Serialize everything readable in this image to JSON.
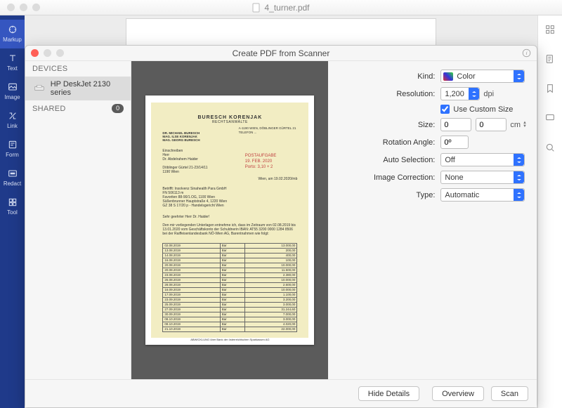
{
  "window": {
    "title": "4_turner.pdf"
  },
  "rail": {
    "items": [
      {
        "label": "Markup"
      },
      {
        "label": "Text"
      },
      {
        "label": "Image"
      },
      {
        "label": "Link"
      },
      {
        "label": "Form"
      },
      {
        "label": "Redact"
      },
      {
        "label": "Tool"
      }
    ]
  },
  "sheet": {
    "title": "Create PDF from Scanner",
    "devices_header": "DEVICES",
    "device_name": "HP DeskJet 2130 series",
    "shared_header": "SHARED",
    "shared_count": "0",
    "settings": {
      "kind_label": "Kind:",
      "kind_value": "Color",
      "res_label": "Resolution:",
      "res_value": "1,200",
      "res_unit": "dpi",
      "custom_label": "Use Custom Size",
      "size_label": "Size:",
      "size_w": "0",
      "size_h": "0",
      "size_unit": "cm",
      "rot_label": "Rotation Angle:",
      "rot_value": "0º",
      "auto_label": "Auto Selection:",
      "auto_value": "Off",
      "corr_label": "Image Correction:",
      "corr_value": "None",
      "type_label": "Type:",
      "type_value": "Automatic"
    },
    "buttons": {
      "hide": "Hide Details",
      "overview": "Overview",
      "scan": "Scan"
    }
  },
  "scanned": {
    "firm": "BURESCH   KORENJAK",
    "sub": "RECHTSANWÄLTE",
    "names": "DR. MICHAEL BURESCH\nMAG. ILSE KORENJAK\nMAG. GEORG BURESCH",
    "right_addr": "A-1190 WIEN, DÖBLINGER GÜRTEL 21\nTELEFON ...",
    "addr_block": "Einschreiben\nHerr\nDr. Abdelrahem Haider\n\nDöblinger Gürtel 21-23/14/11\n1190 Wien",
    "stamp": "POSTAUFGABE\n19. FEB. 2020\nPorto:  3,10 + 2",
    "city_date": "Wien, am 19.02.2020/mb",
    "betrifft": "Betrifft:   Insolvenz Sinahealth Para GmbH\n            FN 506113 m\n            Favoriten 88-90/1.OG, 1100 Wien\n            Süßenbrunner Hauptstraße 4, 1220 Wien\n            GZ 38 S 17/20 p - Handelsgericht Wien",
    "greet": "Sehr geehrter Herr Dr. Haider!",
    "intro": "Den mir vorliegenden Unterlagen entnehme ich, dass im Zeitraum von 02.08.2019 bis 13.01.2020 vom Geschäftskonto der Schuldnerin IBAN: AT55 3200 0000 1284 8506 bei der Raiffeisenlandesbank NÖ-Wien AG, Barentnahmen wie folgt:",
    "rows": [
      [
        "02.08.2019",
        "Bar",
        "13.000,00"
      ],
      [
        "13.08.2019",
        "Bar",
        "200,00"
      ],
      [
        "14.08.2019",
        "Bar",
        "400,00"
      ],
      [
        "16.08.2019",
        "Bar",
        "100,00"
      ],
      [
        "20.08.2019",
        "Bar",
        "10.000,00"
      ],
      [
        "20.08.2019",
        "Bar",
        "11.500,00"
      ],
      [
        "23.08.2019",
        "Bar",
        "2.380,00"
      ],
      [
        "26.08.2019",
        "Bar",
        "10.000,00"
      ],
      [
        "28.08.2019",
        "Bar",
        "2.600,00"
      ],
      [
        "16.09.2019",
        "Bar",
        "10.000,00"
      ],
      [
        "17.09.2019",
        "Bar",
        "1.100,00"
      ],
      [
        "23.09.2019",
        "Bar",
        "3.200,00"
      ],
      [
        "25.09.2019",
        "Bar",
        "3.000,00"
      ],
      [
        "27.09.2019",
        "Bar",
        "31.244,60"
      ],
      [
        "30.09.2019",
        "Bar",
        "7.000,00"
      ],
      [
        "08.10.2019",
        "Bar",
        "3.000,00"
      ],
      [
        "08.10.2019",
        "Bar",
        "4.020,00"
      ],
      [
        "21.10.2019",
        "Bar",
        "22.000,00"
      ]
    ],
    "footer": "ABWICKLUNG über Bank der österreichischen Sparkassen AG"
  }
}
